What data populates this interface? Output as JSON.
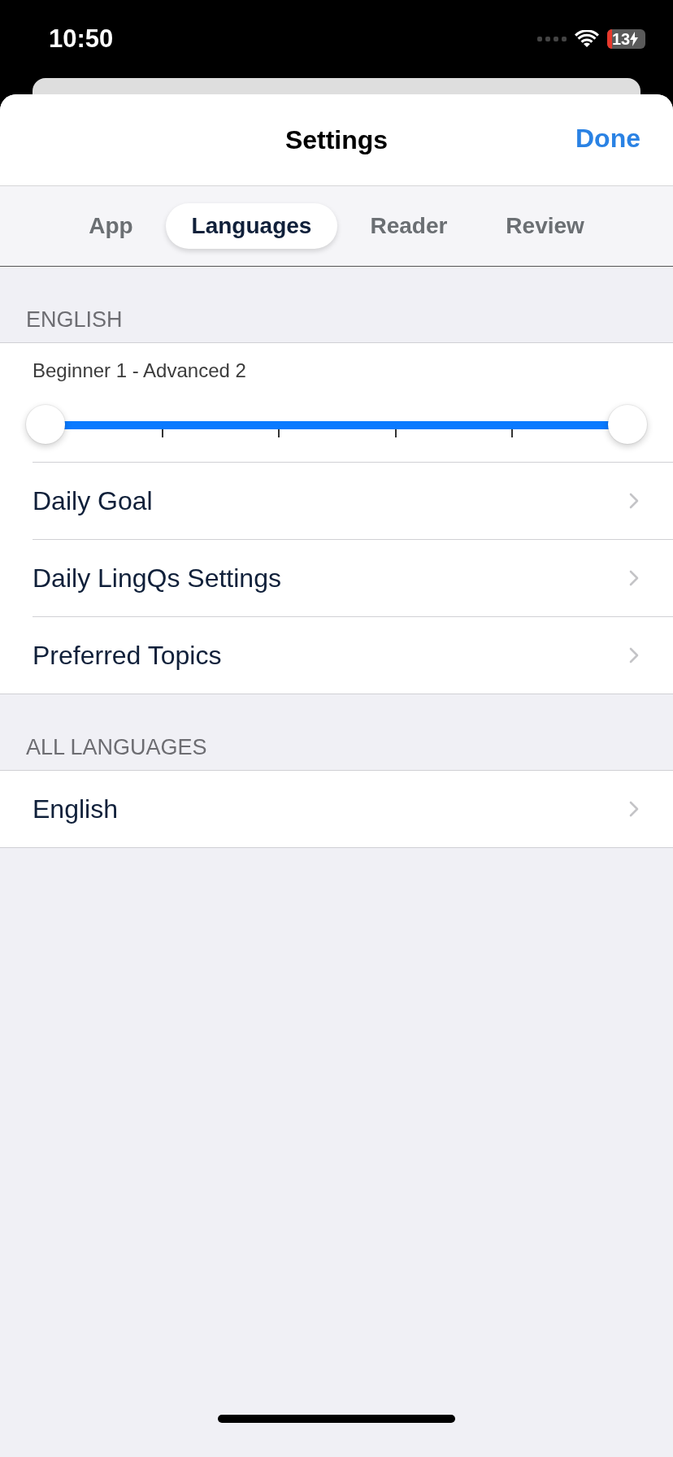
{
  "status_bar": {
    "time": "10:50",
    "battery": "13"
  },
  "header": {
    "title": "Settings",
    "done": "Done"
  },
  "tabs": [
    {
      "label": "App",
      "selected": false
    },
    {
      "label": "Languages",
      "selected": true
    },
    {
      "label": "Reader",
      "selected": false
    },
    {
      "label": "Review",
      "selected": false
    }
  ],
  "sections": [
    {
      "title": "ENGLISH",
      "range": {
        "label": "Beginner 1 - Advanced 2",
        "thumbs": [
          {
            "level": 0
          },
          {
            "level": 1
          }
        ]
      },
      "rows": [
        {
          "label": "Daily Goal"
        },
        {
          "label": "Daily LingQs Settings"
        },
        {
          "label": "Preferred Topics"
        }
      ]
    },
    {
      "title": "ALL LANGUAGES",
      "rows": [
        {
          "label": "English"
        }
      ]
    }
  ]
}
